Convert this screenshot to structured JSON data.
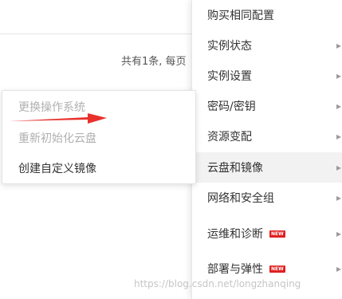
{
  "background": {
    "pagination_text": "共有1条, 每页"
  },
  "main_menu": {
    "items": [
      {
        "label": "购买相同配置",
        "has_submenu": false,
        "badge": null,
        "active": false
      },
      {
        "label": "实例状态",
        "has_submenu": true,
        "badge": null,
        "active": false
      },
      {
        "label": "实例设置",
        "has_submenu": true,
        "badge": null,
        "active": false
      },
      {
        "label": "密码/密钥",
        "has_submenu": true,
        "badge": null,
        "active": false
      },
      {
        "label": "资源变配",
        "has_submenu": true,
        "badge": null,
        "active": false
      },
      {
        "label": "云盘和镜像",
        "has_submenu": true,
        "badge": null,
        "active": true
      },
      {
        "label": "网络和安全组",
        "has_submenu": true,
        "badge": null,
        "active": false
      },
      {
        "label": "运维和诊断",
        "has_submenu": true,
        "badge": "NEW",
        "active": false
      },
      {
        "label": "部署与弹性",
        "has_submenu": true,
        "badge": "NEW",
        "active": false
      }
    ],
    "chevron_icon": "chevron-right-icon"
  },
  "sub_menu": {
    "items": [
      {
        "label": "更换操作系统",
        "disabled": true
      },
      {
        "label": "重新初始化云盘",
        "disabled": true
      },
      {
        "label": "创建自定义镜像",
        "disabled": false
      }
    ]
  },
  "annotation": {
    "arrow_color": "#e8312b",
    "arrow_icon": "red-arrow-icon"
  },
  "watermark": "https://blog.csdn.net/longzhanqing",
  "colors": {
    "badge": "#e02020",
    "active_bg": "#f2f2f2",
    "disabled_text": "#b0b0b0",
    "text": "#333333"
  }
}
